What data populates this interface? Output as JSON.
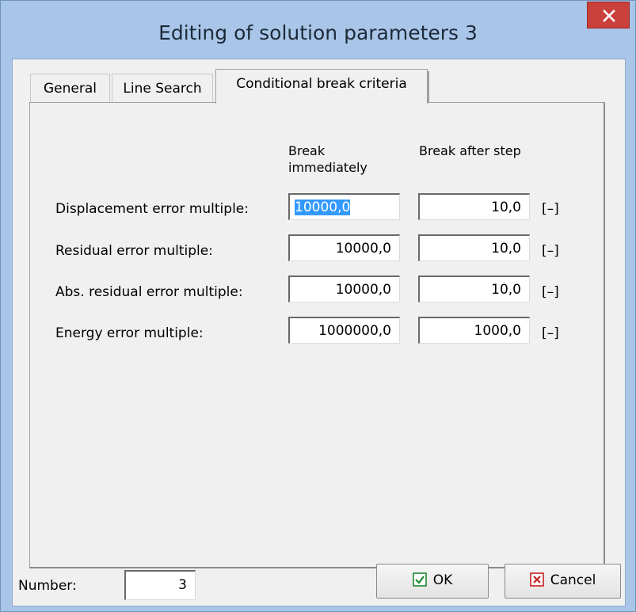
{
  "window": {
    "title": "Editing of solution parameters 3",
    "close_icon": "close-icon"
  },
  "tabs": [
    {
      "label": "General",
      "active": false
    },
    {
      "label": "Line Search",
      "active": false
    },
    {
      "label": "Conditional break criteria",
      "active": true
    }
  ],
  "columns": {
    "break_immediately": "Break immediately",
    "break_after_step": "Break after step"
  },
  "rows": [
    {
      "label": "Displacement error multiple:",
      "immediately": "10000,0",
      "after_step": "10,0",
      "unit": "[–]"
    },
    {
      "label": "Residual error multiple:",
      "immediately": "10000,0",
      "after_step": "10,0",
      "unit": "[–]"
    },
    {
      "label": "Abs. residual error multiple:",
      "immediately": "10000,0",
      "after_step": "10,0",
      "unit": "[–]"
    },
    {
      "label": "Energy error multiple:",
      "immediately": "1000000,0",
      "after_step": "1000,0",
      "unit": "[–]"
    }
  ],
  "footer": {
    "number_label": "Number:",
    "number_value": "3",
    "ok_label": "OK",
    "cancel_label": "Cancel"
  },
  "colors": {
    "frame": "#a9c6e8",
    "close": "#c9413a",
    "ok_icon": "#1e8a2e",
    "cancel_icon": "#c82020",
    "selection": "#3399ff"
  }
}
